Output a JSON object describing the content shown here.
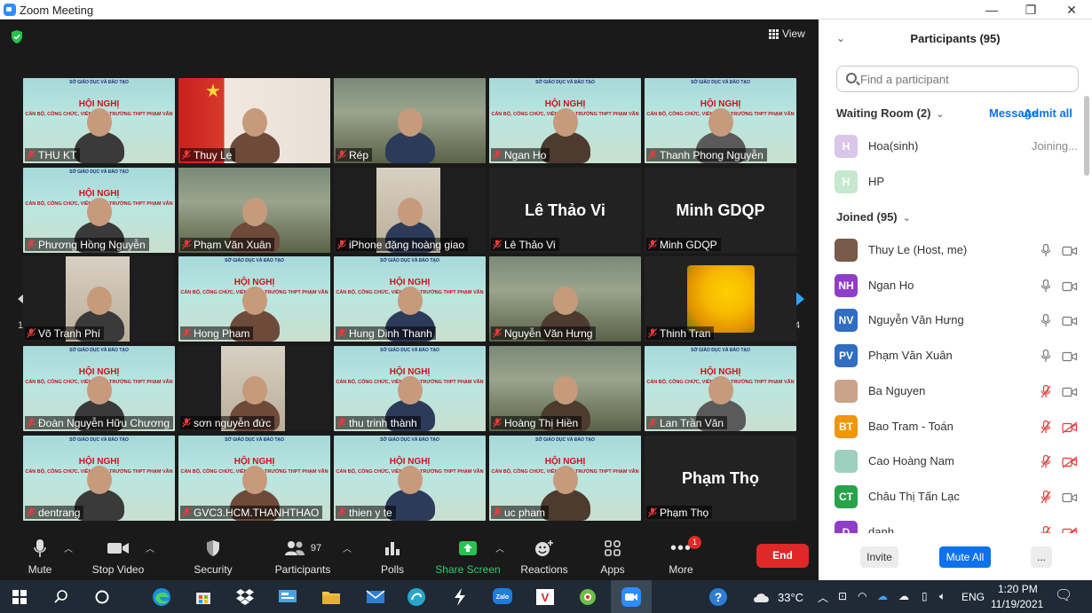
{
  "window": {
    "title": "Zoom Meeting",
    "minimize": "—",
    "maximize": "❐",
    "close": "✕"
  },
  "view_label": "View",
  "pages": {
    "left": "1/4",
    "right": "1/4"
  },
  "tiles": [
    {
      "name": "THU KT",
      "kind": "banner"
    },
    {
      "name": "Thuy Le",
      "kind": "flag"
    },
    {
      "name": "Rép",
      "kind": "room"
    },
    {
      "name": "Ngan Ho",
      "kind": "banner"
    },
    {
      "name": "Thanh Phong Nguyễn",
      "kind": "banner"
    },
    {
      "name": "Phương Hồng Nguyễn",
      "kind": "banner"
    },
    {
      "name": "Phạm Văn Xuân",
      "kind": "room",
      "active": true
    },
    {
      "name": "iPhone đặng hoàng giao",
      "kind": "dark"
    },
    {
      "name": "Lê Thảo Vi",
      "kind": "text",
      "big": "Lê Thảo Vi"
    },
    {
      "name": "Minh GDQP",
      "kind": "text",
      "big": "Minh GDQP"
    },
    {
      "name": "Võ Tranh Phí",
      "kind": "dark"
    },
    {
      "name": "Hong Pham",
      "kind": "banner"
    },
    {
      "name": "Hung Dinh Thanh",
      "kind": "banner"
    },
    {
      "name": "Nguyễn Văn Hưng",
      "kind": "room"
    },
    {
      "name": "Thinh Tran",
      "kind": "flower"
    },
    {
      "name": "Đoàn Nguyễn Hữu Chương",
      "kind": "banner"
    },
    {
      "name": "sơn nguyễn đức",
      "kind": "dark"
    },
    {
      "name": "thu trinh thành",
      "kind": "banner"
    },
    {
      "name": "Hoàng Thị Hiền",
      "kind": "room"
    },
    {
      "name": "Lan Trần Văn",
      "kind": "banner"
    },
    {
      "name": "dentrang",
      "kind": "banner"
    },
    {
      "name": "GVC3.HCM.THANHTHAO",
      "kind": "banner"
    },
    {
      "name": "thien y te",
      "kind": "banner"
    },
    {
      "name": "uc pham",
      "kind": "banner"
    },
    {
      "name": "Phạm Thọ",
      "kind": "text",
      "big": "Phạm Thọ"
    }
  ],
  "banner_sub": "CÁN BỘ, CÔNG CHỨC, VIÊN CHỨC TRƯỜNG THPT PHẠM VĂN SÁNG",
  "toolbar": {
    "mute": "Mute",
    "stop_video": "Stop Video",
    "security": "Security",
    "participants": "Participants",
    "participants_count": "97",
    "polls": "Polls",
    "share_screen": "Share Screen",
    "reactions": "Reactions",
    "apps": "Apps",
    "more": "More",
    "more_badge": "1",
    "end": "End"
  },
  "panel": {
    "title": "Participants (95)",
    "search_placeholder": "Find a participant",
    "waiting_title": "Waiting Room (2)",
    "message": "Message",
    "admit_all": "Admit all",
    "waiting": [
      {
        "initial": "H",
        "name": "Hoa(sinh)",
        "status": "Joining...",
        "color": "#d9c6e8"
      },
      {
        "initial": "H",
        "name": "HP",
        "status": "",
        "color": "#c6e8cf"
      }
    ],
    "joined_title": "Joined (95)",
    "joined": [
      {
        "initial": "",
        "name": "Thuy Le (Host, me)",
        "color": "#7a5a4a",
        "mic": "on",
        "video": "off"
      },
      {
        "initial": "NH",
        "name": "Ngan Ho",
        "color": "#8e3ec7",
        "mic": "on",
        "video": "off"
      },
      {
        "initial": "NV",
        "name": "Nguyễn Văn Hưng",
        "color": "#2f6ec0",
        "mic": "on",
        "video": "off"
      },
      {
        "initial": "PV",
        "name": "Phạm Văn Xuân",
        "color": "#2f6ec0",
        "mic": "on-active",
        "video": "off"
      },
      {
        "initial": "",
        "name": "Ba Nguyen",
        "color": "#c9a48a",
        "mic": "muted",
        "video": "off"
      },
      {
        "initial": "BT",
        "name": "Bao Tram - Toán",
        "color": "#f0960a",
        "mic": "muted",
        "video": "muted"
      },
      {
        "initial": "",
        "name": "Cao Hoàng Nam",
        "color": "#9ed0c0",
        "mic": "muted",
        "video": "muted"
      },
      {
        "initial": "CT",
        "name": "Châu Thị Tấn Lạc",
        "color": "#27a34a",
        "mic": "muted",
        "video": "off"
      },
      {
        "initial": "D",
        "name": "danh",
        "color": "#8e3ec7",
        "mic": "muted",
        "video": "muted"
      }
    ],
    "invite": "Invite",
    "mute_all": "Mute All",
    "more": "..."
  },
  "taskbar": {
    "temp": "33°C",
    "lang": "ENG",
    "time": "1:20 PM",
    "date": "11/19/2021"
  }
}
